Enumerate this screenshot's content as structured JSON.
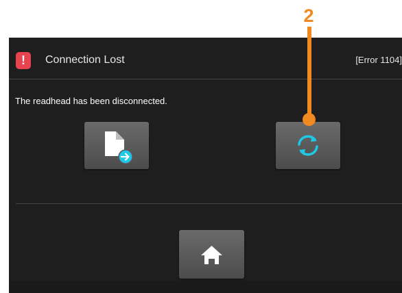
{
  "callout": {
    "number": "2",
    "color": "#f0891f"
  },
  "dialog": {
    "title": "Connection Lost",
    "error_code": "[Error 1104]",
    "message": "The readhead has been disconnected.",
    "alert_icon": "!",
    "alert_color": "#e8434f",
    "accent_color": "#1ec8e6"
  },
  "buttons": {
    "export": {
      "icon": "document-export-icon"
    },
    "reconnect": {
      "icon": "refresh-icon"
    },
    "home": {
      "icon": "home-icon"
    }
  }
}
